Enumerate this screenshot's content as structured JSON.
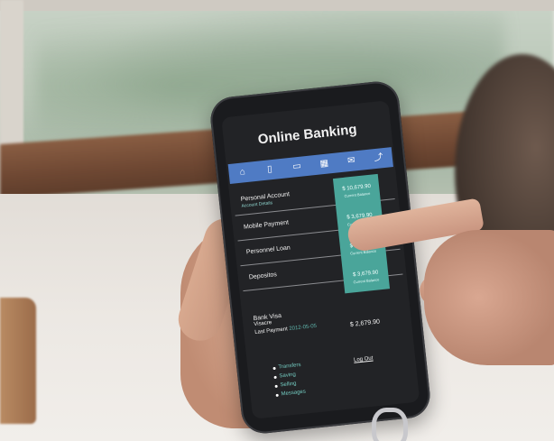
{
  "app": {
    "title": "Online Banking",
    "accent": "#4f7bc4",
    "balance_panel_color": "#4aa59a"
  },
  "tabbar": {
    "icons": [
      "home-icon",
      "wallet-icon",
      "card-icon",
      "calendar-icon",
      "message-icon",
      "share-icon"
    ]
  },
  "accounts": [
    {
      "label": "Personal Account",
      "sub": "Account Details"
    },
    {
      "label": "Mobile Payment",
      "sub": ""
    },
    {
      "label": "Personnel Loan",
      "sub": ""
    },
    {
      "label": "Depositos",
      "sub": ""
    }
  ],
  "balances": [
    {
      "amount": "$ 10,679.90",
      "label": "Current Balance"
    },
    {
      "amount": "$ 3,679.90",
      "label": "Current Balance"
    },
    {
      "amount": "$ 3,679.90",
      "label": "Current Balance"
    },
    {
      "amount": "$ 3,679.90",
      "label": "Current Balance"
    }
  ],
  "bank": {
    "name": "Bank Visa",
    "line2": "Visacre",
    "last_payment_label": "Last Payment",
    "last_payment_date": "2012-05-05",
    "amount": "$ 2,679.90"
  },
  "menu": {
    "items": [
      "Transfers",
      "Saving",
      "Selling",
      "Messages"
    ],
    "logout": "Log Out"
  }
}
